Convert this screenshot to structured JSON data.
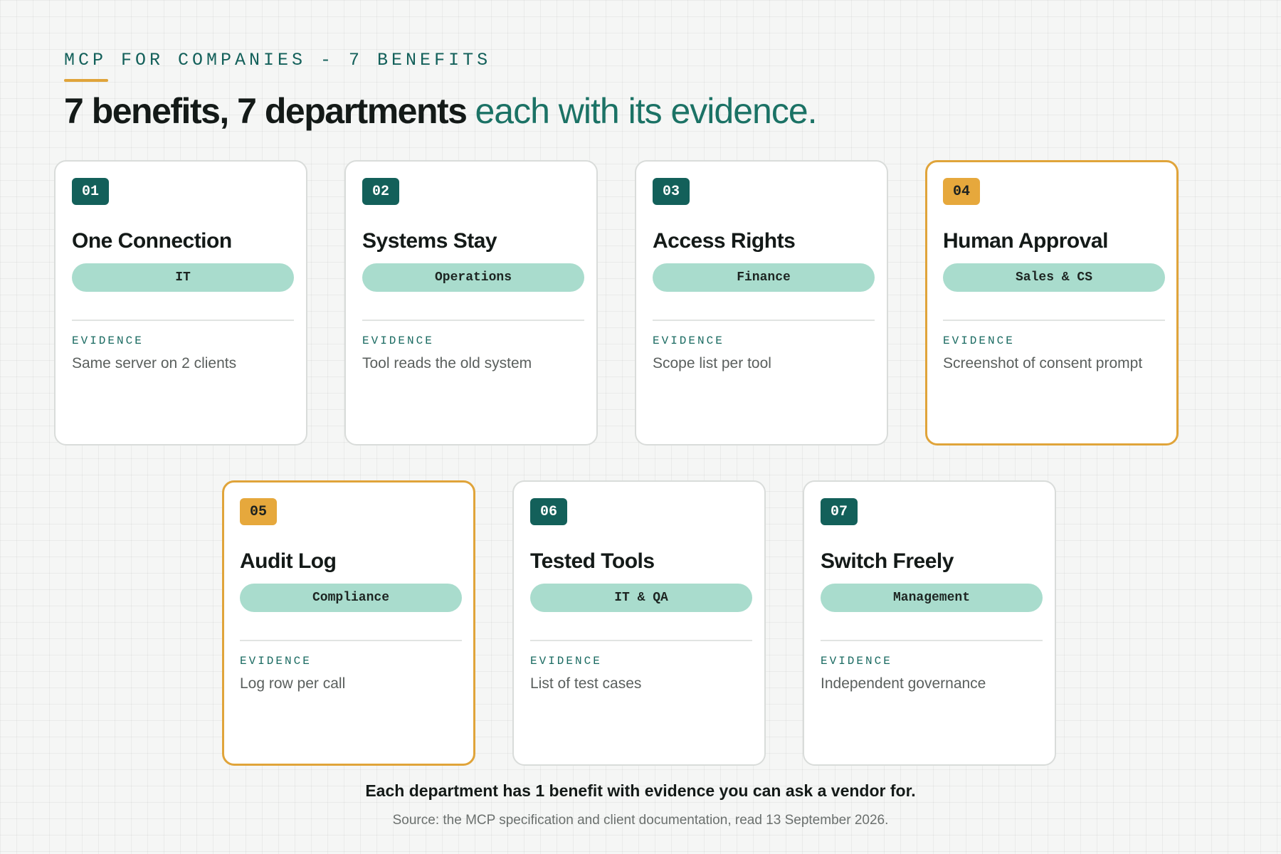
{
  "header": {
    "eyebrow": "MCP FOR COMPANIES - 7 BENEFITS",
    "headline_strong": "7 benefits, 7 departments",
    "headline_soft": "each with its evidence."
  },
  "colors": {
    "primary": "#13605a",
    "accent": "#e0a43a",
    "pill": "#a9dccd",
    "background": "#f5f6f5"
  },
  "cards": [
    {
      "number": "01",
      "title": "One Connection",
      "department": "IT",
      "evidence_label": "EVIDENCE",
      "evidence": "Same server on 2 clients",
      "highlighted": false
    },
    {
      "number": "02",
      "title": "Systems Stay",
      "department": "Operations",
      "evidence_label": "EVIDENCE",
      "evidence": "Tool reads the old system",
      "highlighted": false
    },
    {
      "number": "03",
      "title": "Access Rights",
      "department": "Finance",
      "evidence_label": "EVIDENCE",
      "evidence": "Scope list per tool",
      "highlighted": false
    },
    {
      "number": "04",
      "title": "Human Approval",
      "department": "Sales & CS",
      "evidence_label": "EVIDENCE",
      "evidence": "Screenshot of consent prompt",
      "highlighted": true
    },
    {
      "number": "05",
      "title": "Audit Log",
      "department": "Compliance",
      "evidence_label": "EVIDENCE",
      "evidence": "Log row per call",
      "highlighted": true
    },
    {
      "number": "06",
      "title": "Tested Tools",
      "department": "IT & QA",
      "evidence_label": "EVIDENCE",
      "evidence": "List of test cases",
      "highlighted": false
    },
    {
      "number": "07",
      "title": "Switch Freely",
      "department": "Management",
      "evidence_label": "EVIDENCE",
      "evidence": "Independent governance",
      "highlighted": false
    }
  ],
  "footer": {
    "summary": "Each department has 1 benefit with evidence you can ask a vendor for.",
    "source": "Source: the MCP specification and client documentation, read 13 September 2026."
  }
}
